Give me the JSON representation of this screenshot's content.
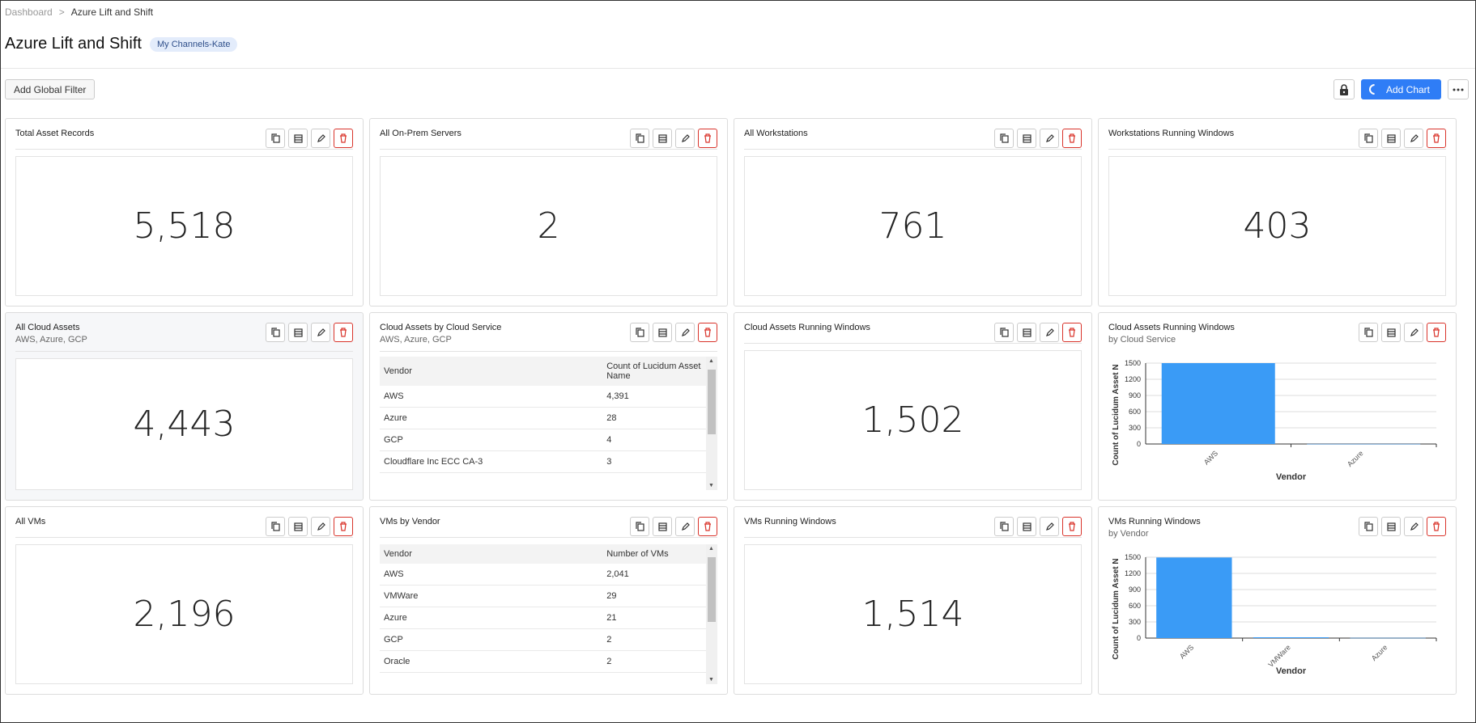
{
  "breadcrumb": {
    "root": "Dashboard",
    "separator": ">",
    "current": "Azure Lift and Shift"
  },
  "page": {
    "title": "Azure Lift and Shift",
    "badge": "My Channels-Kate"
  },
  "toolbar": {
    "global_filter": "Add Global Filter",
    "add_chart": "Add Chart"
  },
  "colors": {
    "accent": "#2f7df6",
    "bar": "#3a9bf6",
    "danger": "#d9342b"
  },
  "cards": [
    {
      "title": "Total Asset Records",
      "value": "5,518"
    },
    {
      "title": "All On-Prem Servers",
      "value": "2"
    },
    {
      "title": "All Workstations",
      "value": "761"
    },
    {
      "title": "Workstations Running Windows",
      "value": "403"
    },
    {
      "title": "All Cloud Assets",
      "subtitle": "AWS, Azure, GCP",
      "value": "4,443"
    },
    {
      "title": "Cloud Assets by Cloud Service",
      "subtitle": "AWS, Azure, GCP",
      "table": {
        "headers": [
          "Vendor",
          "Count of Lucidum Asset Name"
        ],
        "rows": [
          [
            "AWS",
            "4,391"
          ],
          [
            "Azure",
            "28"
          ],
          [
            "GCP",
            "4"
          ],
          [
            "Cloudflare Inc ECC CA-3",
            "3"
          ]
        ]
      }
    },
    {
      "title": "Cloud Assets Running Windows",
      "value": "1,502"
    },
    {
      "title": "Cloud Assets Running Windows",
      "subtitle": "by Cloud Service"
    },
    {
      "title": "All VMs",
      "value": "2,196"
    },
    {
      "title": "VMs by Vendor",
      "table": {
        "headers": [
          "Vendor",
          "Number of VMs"
        ],
        "rows": [
          [
            "AWS",
            "2,041"
          ],
          [
            "VMWare",
            "29"
          ],
          [
            "Azure",
            "21"
          ],
          [
            "GCP",
            "2"
          ],
          [
            "Oracle",
            "2"
          ]
        ]
      }
    },
    {
      "title": "VMs Running Windows",
      "value": "1,514"
    },
    {
      "title": "VMs Running Windows",
      "subtitle": "by Vendor"
    }
  ],
  "chart_data": [
    {
      "type": "bar",
      "title": "Cloud Assets Running Windows",
      "categories": [
        "AWS",
        "Azure"
      ],
      "values": [
        1500,
        2
      ],
      "xlabel": "Vendor",
      "ylabel": "Count of Lucidum Asset N",
      "ylim": [
        0,
        1500
      ],
      "yticks": [
        0,
        300,
        600,
        900,
        1200,
        1500
      ],
      "grid": true
    },
    {
      "type": "bar",
      "title": "VMs Running Windows",
      "categories": [
        "AWS",
        "VMWare",
        "Azure"
      ],
      "values": [
        1495,
        15,
        4
      ],
      "xlabel": "Vendor",
      "ylabel": "Count of Lucidum Asset N",
      "ylim": [
        0,
        1500
      ],
      "yticks": [
        0,
        300,
        600,
        900,
        1200,
        1500
      ],
      "grid": true
    }
  ]
}
